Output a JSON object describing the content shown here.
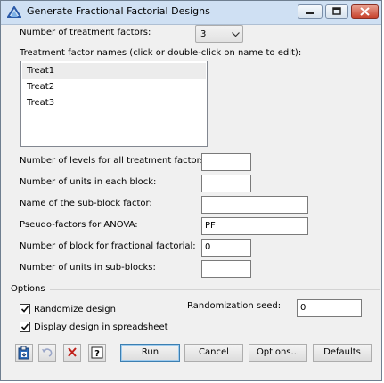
{
  "window": {
    "title": "Generate Fractional Factorial Designs"
  },
  "form": {
    "num_treatment_factors_label": "Number of treatment factors:",
    "num_treatment_factors_value": "3",
    "factor_names_label": "Treatment factor names (click or double-click on name to edit):",
    "factor_names": [
      "Treat1",
      "Treat2",
      "Treat3"
    ],
    "num_levels_label": "Number of levels for all treatment factors:",
    "num_levels_value": "",
    "units_per_block_label": "Number of units in each block:",
    "units_per_block_value": "",
    "subblock_factor_label": "Name of the sub-block factor:",
    "subblock_factor_value": "",
    "pseudo_factors_label": "Pseudo-factors for ANOVA:",
    "pseudo_factors_value": "PF",
    "num_block_fractional_label": "Number of block for fractional factorial:",
    "num_block_fractional_value": "0",
    "units_subblocks_label": "Number of units in sub-blocks:",
    "units_subblocks_value": ""
  },
  "options": {
    "section_label": "Options",
    "randomize_label": "Randomize design",
    "randomize_checked": true,
    "display_spreadsheet_label": "Display design in spreadsheet",
    "display_spreadsheet_checked": true,
    "seed_label": "Randomization seed:",
    "seed_value": "0"
  },
  "buttons": {
    "run": "Run",
    "cancel": "Cancel",
    "options": "Options...",
    "defaults": "Defaults"
  },
  "icons": [
    "app-icon",
    "minimize-icon",
    "maximize-icon",
    "close-icon",
    "paste-icon",
    "undo-icon",
    "clear-icon",
    "help-icon"
  ],
  "colors": {
    "titlebar": "#cfe0f3",
    "dialog_bg": "#f0f0f0",
    "close_button": "#c7422c",
    "default_button_border": "#3c7fb1"
  }
}
